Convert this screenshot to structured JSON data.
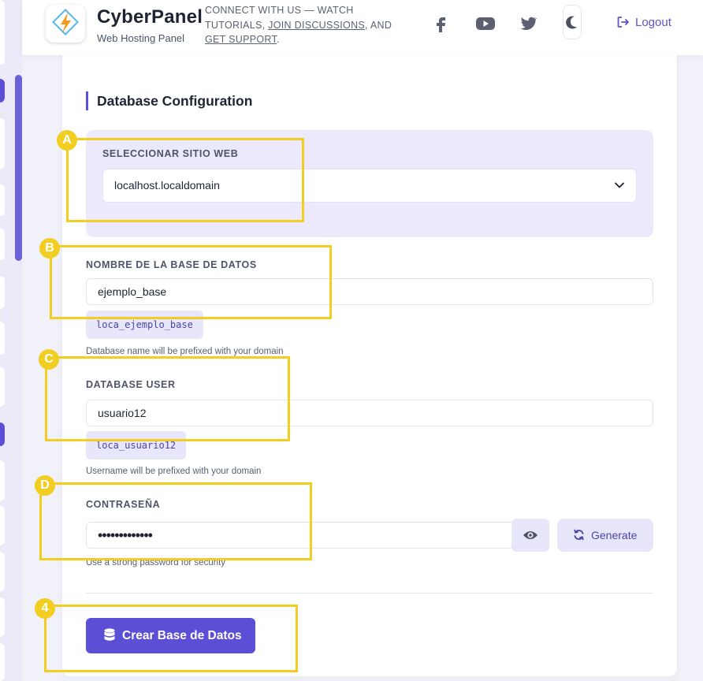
{
  "header": {
    "brand_name": "CyberPanel",
    "brand_sub": "Web Hosting Panel",
    "connect_prefix": "Connect with us — watch tutorials, ",
    "connect_link1": "join discussions",
    "connect_mid": ", and ",
    "connect_link2": "get support",
    "connect_suffix": ".",
    "logout_label": "Logout",
    "icons": [
      "facebook-icon",
      "youtube-icon",
      "twitter-icon",
      "moon-icon",
      "logout-icon"
    ]
  },
  "form": {
    "section_title": "Database Configuration",
    "website_label": "Seleccionar sitio web",
    "website_value": "localhost.localdomain",
    "db_name_label": "Nombre de la base de datos",
    "db_name_value": "ejemplo_base",
    "db_name_prefixed": "loca_ejemplo_base",
    "db_name_help": "Database name will be prefixed with your domain",
    "db_user_label": "Database User",
    "db_user_value": "usuario12",
    "db_user_prefixed": "loca_usuario12",
    "db_user_help": "Username will be prefixed with your domain",
    "password_label": "Contraseña",
    "password_value": "•••••••••••••",
    "password_help": "Use a strong password for security",
    "generate_label": "Generate",
    "create_label": "Crear Base de Datos"
  },
  "annotations": {
    "markers": [
      "A",
      "B",
      "C",
      "D",
      "4"
    ],
    "color": "#f2ce22"
  },
  "colors": {
    "accent": "#5b4fd6",
    "accent_soft": "#e8e6fb",
    "panel_bg": "#ebe9fb"
  }
}
